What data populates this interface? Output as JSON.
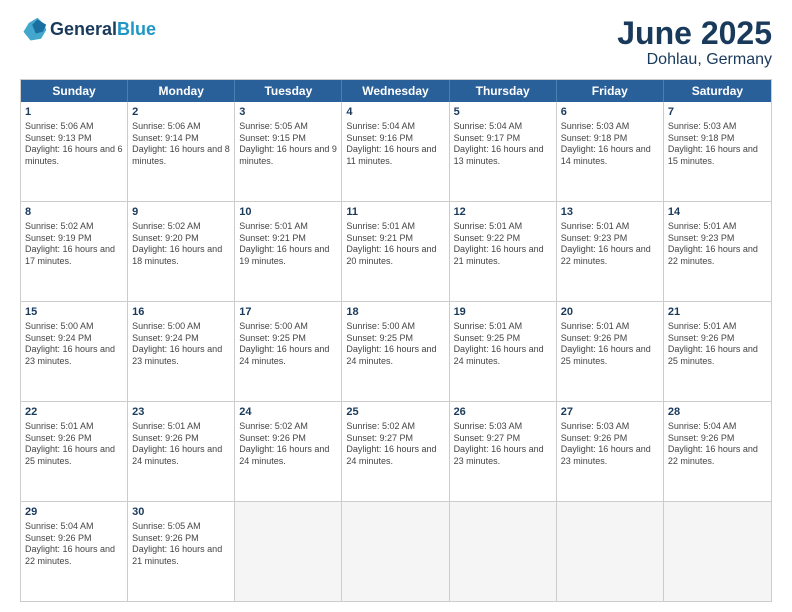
{
  "header": {
    "logo_line1": "General",
    "logo_line2": "Blue",
    "title": "June 2025",
    "subtitle": "Dohlau, Germany"
  },
  "calendar": {
    "weekdays": [
      "Sunday",
      "Monday",
      "Tuesday",
      "Wednesday",
      "Thursday",
      "Friday",
      "Saturday"
    ],
    "rows": [
      [
        {
          "day": "",
          "empty": true
        },
        {
          "day": "",
          "empty": true
        },
        {
          "day": "",
          "empty": true
        },
        {
          "day": "",
          "empty": true
        },
        {
          "day": "",
          "empty": true
        },
        {
          "day": "",
          "empty": true
        },
        {
          "day": "",
          "empty": true
        }
      ],
      [
        {
          "day": "1",
          "rise": "5:06 AM",
          "set": "9:13 PM",
          "daylight": "16 hours and 6 minutes."
        },
        {
          "day": "2",
          "rise": "5:06 AM",
          "set": "9:14 PM",
          "daylight": "16 hours and 8 minutes."
        },
        {
          "day": "3",
          "rise": "5:05 AM",
          "set": "9:15 PM",
          "daylight": "16 hours and 9 minutes."
        },
        {
          "day": "4",
          "rise": "5:04 AM",
          "set": "9:16 PM",
          "daylight": "16 hours and 11 minutes."
        },
        {
          "day": "5",
          "rise": "5:04 AM",
          "set": "9:17 PM",
          "daylight": "16 hours and 13 minutes."
        },
        {
          "day": "6",
          "rise": "5:03 AM",
          "set": "9:18 PM",
          "daylight": "16 hours and 14 minutes."
        },
        {
          "day": "7",
          "rise": "5:03 AM",
          "set": "9:18 PM",
          "daylight": "16 hours and 15 minutes."
        }
      ],
      [
        {
          "day": "8",
          "rise": "5:02 AM",
          "set": "9:19 PM",
          "daylight": "16 hours and 17 minutes."
        },
        {
          "day": "9",
          "rise": "5:02 AM",
          "set": "9:20 PM",
          "daylight": "16 hours and 18 minutes."
        },
        {
          "day": "10",
          "rise": "5:01 AM",
          "set": "9:21 PM",
          "daylight": "16 hours and 19 minutes."
        },
        {
          "day": "11",
          "rise": "5:01 AM",
          "set": "9:21 PM",
          "daylight": "16 hours and 20 minutes."
        },
        {
          "day": "12",
          "rise": "5:01 AM",
          "set": "9:22 PM",
          "daylight": "16 hours and 21 minutes."
        },
        {
          "day": "13",
          "rise": "5:01 AM",
          "set": "9:23 PM",
          "daylight": "16 hours and 22 minutes."
        },
        {
          "day": "14",
          "rise": "5:01 AM",
          "set": "9:23 PM",
          "daylight": "16 hours and 22 minutes."
        }
      ],
      [
        {
          "day": "15",
          "rise": "5:00 AM",
          "set": "9:24 PM",
          "daylight": "16 hours and 23 minutes."
        },
        {
          "day": "16",
          "rise": "5:00 AM",
          "set": "9:24 PM",
          "daylight": "16 hours and 23 minutes."
        },
        {
          "day": "17",
          "rise": "5:00 AM",
          "set": "9:25 PM",
          "daylight": "16 hours and 24 minutes."
        },
        {
          "day": "18",
          "rise": "5:00 AM",
          "set": "9:25 PM",
          "daylight": "16 hours and 24 minutes."
        },
        {
          "day": "19",
          "rise": "5:01 AM",
          "set": "9:25 PM",
          "daylight": "16 hours and 24 minutes."
        },
        {
          "day": "20",
          "rise": "5:01 AM",
          "set": "9:26 PM",
          "daylight": "16 hours and 25 minutes."
        },
        {
          "day": "21",
          "rise": "5:01 AM",
          "set": "9:26 PM",
          "daylight": "16 hours and 25 minutes."
        }
      ],
      [
        {
          "day": "22",
          "rise": "5:01 AM",
          "set": "9:26 PM",
          "daylight": "16 hours and 25 minutes."
        },
        {
          "day": "23",
          "rise": "5:01 AM",
          "set": "9:26 PM",
          "daylight": "16 hours and 24 minutes."
        },
        {
          "day": "24",
          "rise": "5:02 AM",
          "set": "9:26 PM",
          "daylight": "16 hours and 24 minutes."
        },
        {
          "day": "25",
          "rise": "5:02 AM",
          "set": "9:27 PM",
          "daylight": "16 hours and 24 minutes."
        },
        {
          "day": "26",
          "rise": "5:03 AM",
          "set": "9:27 PM",
          "daylight": "16 hours and 23 minutes."
        },
        {
          "day": "27",
          "rise": "5:03 AM",
          "set": "9:26 PM",
          "daylight": "16 hours and 23 minutes."
        },
        {
          "day": "28",
          "rise": "5:04 AM",
          "set": "9:26 PM",
          "daylight": "16 hours and 22 minutes."
        }
      ],
      [
        {
          "day": "29",
          "rise": "5:04 AM",
          "set": "9:26 PM",
          "daylight": "16 hours and 22 minutes."
        },
        {
          "day": "30",
          "rise": "5:05 AM",
          "set": "9:26 PM",
          "daylight": "16 hours and 21 minutes."
        },
        {
          "day": "",
          "empty": true
        },
        {
          "day": "",
          "empty": true
        },
        {
          "day": "",
          "empty": true
        },
        {
          "day": "",
          "empty": true
        },
        {
          "day": "",
          "empty": true
        }
      ]
    ]
  }
}
